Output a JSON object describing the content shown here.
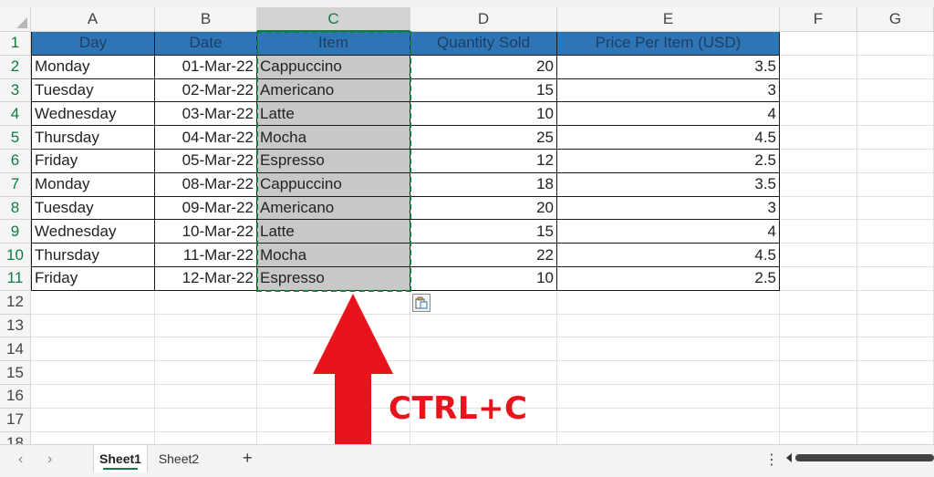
{
  "columns": [
    "A",
    "B",
    "C",
    "D",
    "E",
    "F",
    "G"
  ],
  "rows": [
    "1",
    "2",
    "3",
    "4",
    "5",
    "6",
    "7",
    "8",
    "9",
    "10",
    "11",
    "12",
    "13",
    "14",
    "15",
    "16",
    "17",
    "18"
  ],
  "table": {
    "headers": [
      "Day",
      "Date",
      "Item",
      "Quantity Sold",
      "Price Per Item (USD)"
    ],
    "data": [
      [
        "Monday",
        "01-Mar-22",
        "Cappuccino",
        "20",
        "3.5"
      ],
      [
        "Tuesday",
        "02-Mar-22",
        "Americano",
        "15",
        "3"
      ],
      [
        "Wednesday",
        "03-Mar-22",
        "Latte",
        "10",
        "4"
      ],
      [
        "Thursday",
        "04-Mar-22",
        "Mocha",
        "25",
        "4.5"
      ],
      [
        "Friday",
        "05-Mar-22",
        "Espresso",
        "12",
        "2.5"
      ],
      [
        "Monday",
        "08-Mar-22",
        "Cappuccino",
        "18",
        "3.5"
      ],
      [
        "Tuesday",
        "09-Mar-22",
        "Americano",
        "20",
        "3"
      ],
      [
        "Wednesday",
        "10-Mar-22",
        "Latte",
        "15",
        "4"
      ],
      [
        "Thursday",
        "11-Mar-22",
        "Mocha",
        "22",
        "4.5"
      ],
      [
        "Friday",
        "12-Mar-22",
        "Espresso",
        "10",
        "2.5"
      ]
    ]
  },
  "selection": {
    "column": "C"
  },
  "annotation": {
    "label": "CTRL+C",
    "color": "#e8141c",
    "icon": "up-arrow-icon"
  },
  "tabs": [
    {
      "label": "Sheet1",
      "active": true
    },
    {
      "label": "Sheet2",
      "active": false
    }
  ],
  "tabbar": {
    "prev_icon": "‹",
    "next_icon": "›",
    "add_label": "+",
    "more_label": "⋮"
  },
  "colors": {
    "accent": "#107c41",
    "header_fill": "#2e75b6",
    "selection_fill": "#c8c8c8"
  }
}
